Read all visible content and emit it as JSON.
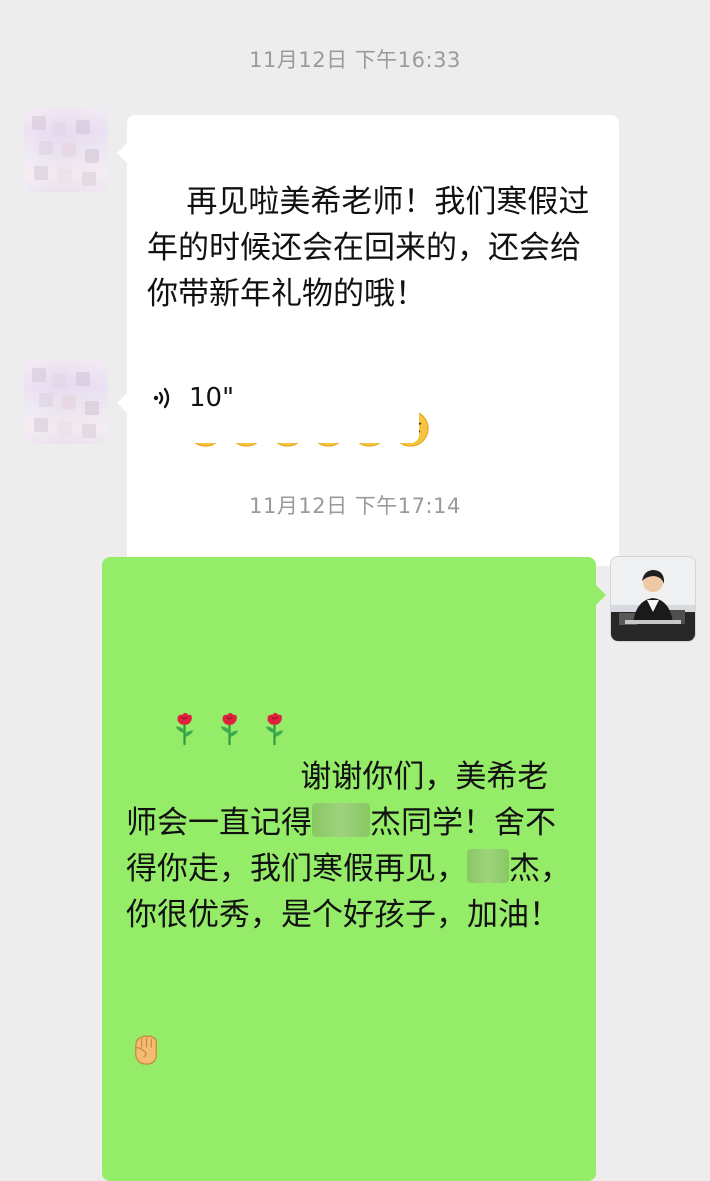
{
  "messages": {
    "timestamp1": "11月12日 下午16:33",
    "incoming_text": "再见啦美希老师！我们寒假过年的时候还会在回来的，还会给你带新年礼物的哦！",
    "voice_duration": "10\"",
    "timestamp2": "11月12日 下午17:14",
    "outgoing_part1": "谢谢你们，美希老师会一直记得",
    "outgoing_part2": "杰同学！舍不得你走，我们寒假再见，",
    "outgoing_part3": "杰，你很优秀，是个好孩子，加油！"
  },
  "icons": {
    "smile_emoji": "yum-emoji-icon",
    "tongue_emoji": "winking-tongue-emoji-icon",
    "flower_emoji": "rose-emoji-icon",
    "fist_emoji": "raised-fist-emoji-icon",
    "voice": "voice-wave-icon"
  },
  "colors": {
    "page_background": "#ededed",
    "incoming_bubble": "#ffffff",
    "outgoing_bubble": "#95ec69",
    "timestamp_text": "#9a9a9a"
  }
}
